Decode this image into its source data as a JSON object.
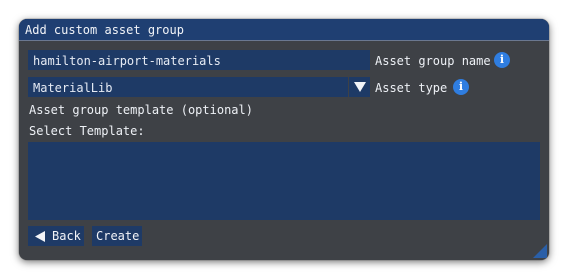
{
  "dialog": {
    "title": "Add custom asset group"
  },
  "fields": {
    "asset_group_name": {
      "value": "hamilton-airport-materials",
      "label": "Asset group name"
    },
    "asset_type": {
      "value": "MaterialLib",
      "label": "Asset type"
    }
  },
  "template": {
    "optional_label": "Asset group template (optional)",
    "select_label": "Select Template:"
  },
  "buttons": {
    "back": "Back",
    "create": "Create"
  },
  "icons": {
    "info": "i",
    "info_icon_name": "info-icon",
    "dropdown_icon_name": "chevron-down-icon",
    "back_icon_name": "arrow-left-icon",
    "resize_icon_name": "resize-grip-icon"
  },
  "colors": {
    "titlebar": "#1f3f72",
    "panel": "#3e4146",
    "field": "#1e3a66",
    "info_accent": "#2f7de0"
  }
}
